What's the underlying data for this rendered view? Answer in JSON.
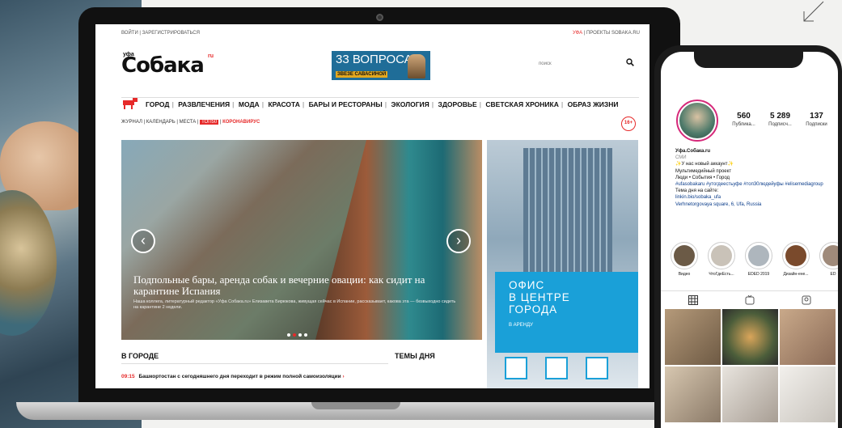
{
  "site": {
    "top_login": "ВОЙТИ | ЗАРЕГИСТРИРОВАТЬСЯ",
    "top_city": "УФА",
    "top_projects": "| ПРОЕКТЫ SOBAKA.RU",
    "logo_small": "уфа",
    "logo": "Собака",
    "logo_suffix": "ru",
    "banner_title": "33 ВОПРОСА",
    "banner_sub": "ЗВЕЗЕ САВАСИНОЙ",
    "search_placeholder": "поиск",
    "nav": [
      "ГОРОД",
      "РАЗВЛЕЧЕНИЯ",
      "МОДА",
      "КРАСОТА",
      "БАРЫ И РЕСТОРАНЫ",
      "ЭКОЛОГИЯ",
      "ЗДОРОВЬЕ",
      "СВЕТСКАЯ ХРОНИКА",
      "ОБРАЗ ЖИЗНИ"
    ],
    "subnav": {
      "a": "ЖУРНАЛ",
      "b": "КАЛЕНДАРЬ",
      "c": "МЕСТА",
      "d": "ТОП50",
      "e": "КОРОНАВИРУС"
    },
    "age": "16+",
    "slide_title": "Подпольные бары, аренда собак и вечерние овации: как сидит на карантине Испания",
    "slide_lead": "Наша коллега, литературный редактор «Уфа Собака.ru» Елизавета Бирюкова, живущая сейчас в Испании, рассказывает, какова эта — безвыходно сидеть на карантине 2 недели.",
    "ad_text_1": "ОФИС",
    "ad_text_2": "В ЦЕНТРЕ",
    "ad_text_3": "ГОРОДА",
    "ad_sub": "В АРЕНДУ",
    "section_head": "В ГОРОДЕ",
    "news_time": "09:15",
    "news_text": "Башкортостан с сегодняшнего дня переходит в режим полной самоизоляции",
    "themes_head": "ТЕМЫ ДНЯ"
  },
  "instagram": {
    "stats": [
      {
        "num": "560",
        "label": "Публика..."
      },
      {
        "num": "5 289",
        "label": "Подписч..."
      },
      {
        "num": "137",
        "label": "Подписки"
      }
    ],
    "name": "Уфа.Собака.ru",
    "category": "СМИ",
    "bio": [
      "✨У нас новый аккаунт✨",
      "Мультимедийный проект",
      "Люди • События • Город"
    ],
    "hashtags": "#ufasobakaru #утогдеестьуфе #топ30людейуфы #elisemediagroup",
    "bio_more": "Тема дня на сайте:",
    "link": "linkin.bio/sobaka_ufa",
    "address": "Verhnetorgovaya square, 6, Ufa, Russia",
    "stories": [
      "Видео",
      "ЧтоГдеЕсть...",
      "EDED 2019",
      "Дизайн-ене...",
      "ED"
    ]
  },
  "colors": {
    "accent": "#e62a2a",
    "banner": "#1f6d98",
    "ad_blue": "#1aa0d8"
  }
}
